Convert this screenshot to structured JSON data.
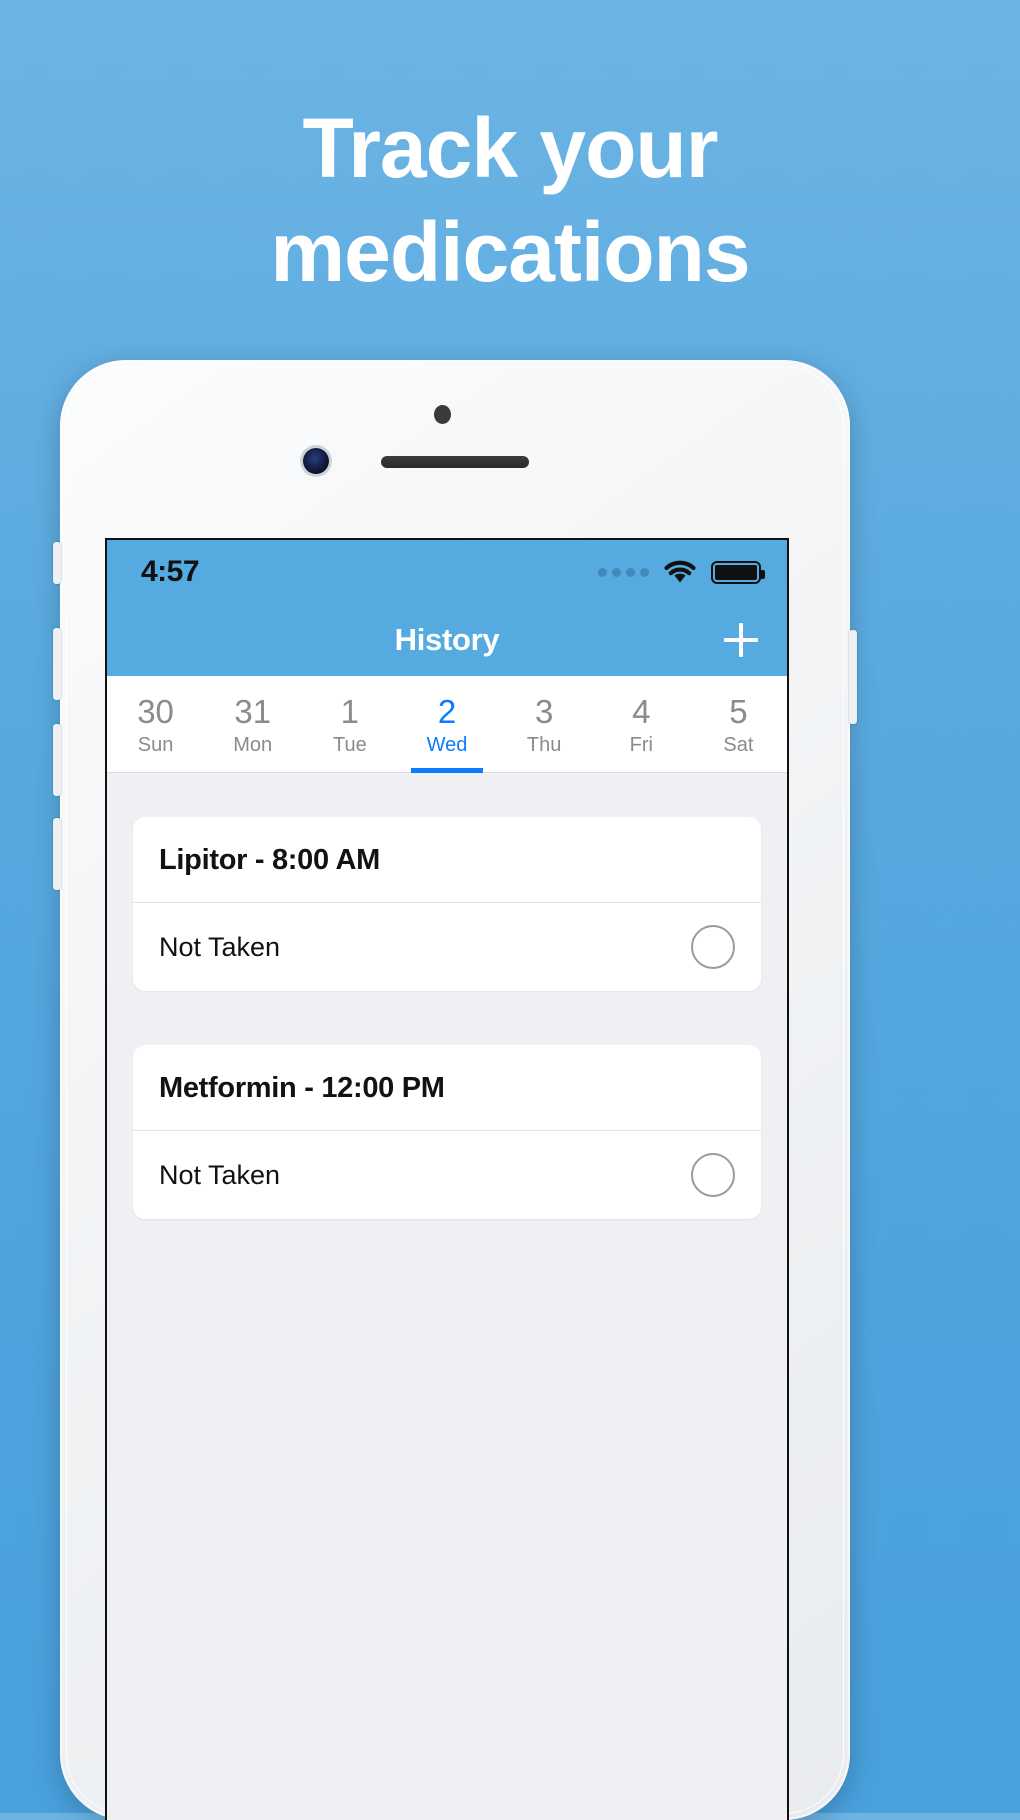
{
  "headline": {
    "line1": "Track your",
    "line2": "medications"
  },
  "colors": {
    "background_top": "#6cb4e4",
    "background_bottom": "#49a0dc",
    "nav_bar": "#55abdf",
    "accent_blue": "#0a7cff",
    "screen_bg": "#f0f0f4",
    "card_bg": "#ffffff",
    "muted_text": "#8a8a8f"
  },
  "phone": {
    "hardware": {
      "earpiece": "earpiece-speaker",
      "front_camera": "front-camera",
      "proximity_sensor": "proximity-sensor"
    }
  },
  "status_bar": {
    "time": "4:57",
    "signal_dots": 4,
    "wifi_icon": "wifi-icon",
    "battery_icon": "battery-full-icon"
  },
  "nav_bar": {
    "title": "History",
    "add_button_icon": "plus-icon",
    "add_button_label": "+"
  },
  "date_strip": {
    "days": [
      {
        "num": "30",
        "name": "Sun",
        "selected": false
      },
      {
        "num": "31",
        "name": "Mon",
        "selected": false
      },
      {
        "num": "1",
        "name": "Tue",
        "selected": false
      },
      {
        "num": "2",
        "name": "Wed",
        "selected": true
      },
      {
        "num": "3",
        "name": "Thu",
        "selected": false
      },
      {
        "num": "4",
        "name": "Fri",
        "selected": false
      },
      {
        "num": "5",
        "name": "Sat",
        "selected": false
      }
    ]
  },
  "medications": [
    {
      "title": "Lipitor - 8:00 AM",
      "name": "Lipitor",
      "time": "8:00 AM",
      "status": "Not Taken",
      "toggle_icon": "empty-circle-icon",
      "taken": false
    },
    {
      "title": "Metformin - 12:00 PM",
      "name": "Metformin",
      "time": "12:00 PM",
      "status": "Not Taken",
      "toggle_icon": "empty-circle-icon",
      "taken": false
    }
  ]
}
